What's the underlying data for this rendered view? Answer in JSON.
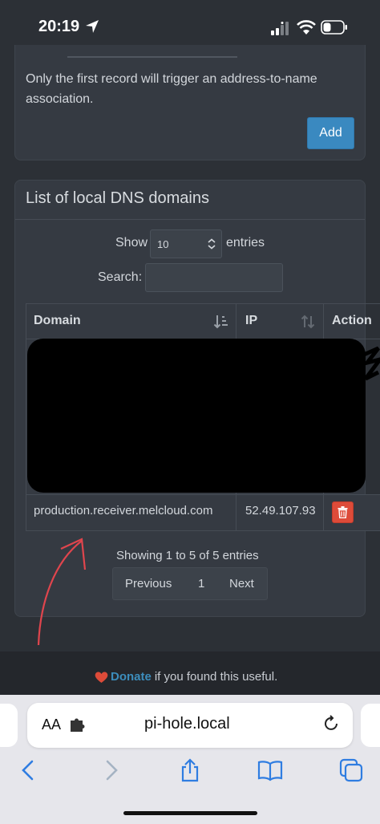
{
  "status_bar": {
    "time": "20:19",
    "icons": [
      "location-arrow-icon",
      "cellular-signal-icon",
      "wifi-icon",
      "battery-icon"
    ]
  },
  "dhcp_panel": {
    "help_text": "Only the first record will trigger an address-to-name association.",
    "add_label": "Add"
  },
  "dns_list": {
    "title": "List of local DNS domains",
    "length_menu": {
      "show_label": "Show",
      "selected": "10",
      "entries_label": "entries"
    },
    "search": {
      "label": "Search:",
      "value": ""
    },
    "columns": [
      "Domain",
      "IP",
      "Action"
    ],
    "rows": [
      {
        "domain": "production.receiver.melcloud.com",
        "ip": "52.49.107.93"
      }
    ],
    "info": "Showing 1 to 5 of 5 entries",
    "pagination": {
      "previous": "Previous",
      "current": "1",
      "next": "Next"
    }
  },
  "footer": {
    "donate_link": "Donate",
    "donate_suffix": "if you found this useful."
  },
  "browser": {
    "aa_label": "AA",
    "url": "pi-hole.local"
  },
  "colors": {
    "background": "#2c3036",
    "panel": "#353a42",
    "primary_button": "#3a89c0",
    "danger_button": "#dd4b39",
    "link": "#3c8dbc",
    "annotation_arrow": "#e0454d"
  }
}
